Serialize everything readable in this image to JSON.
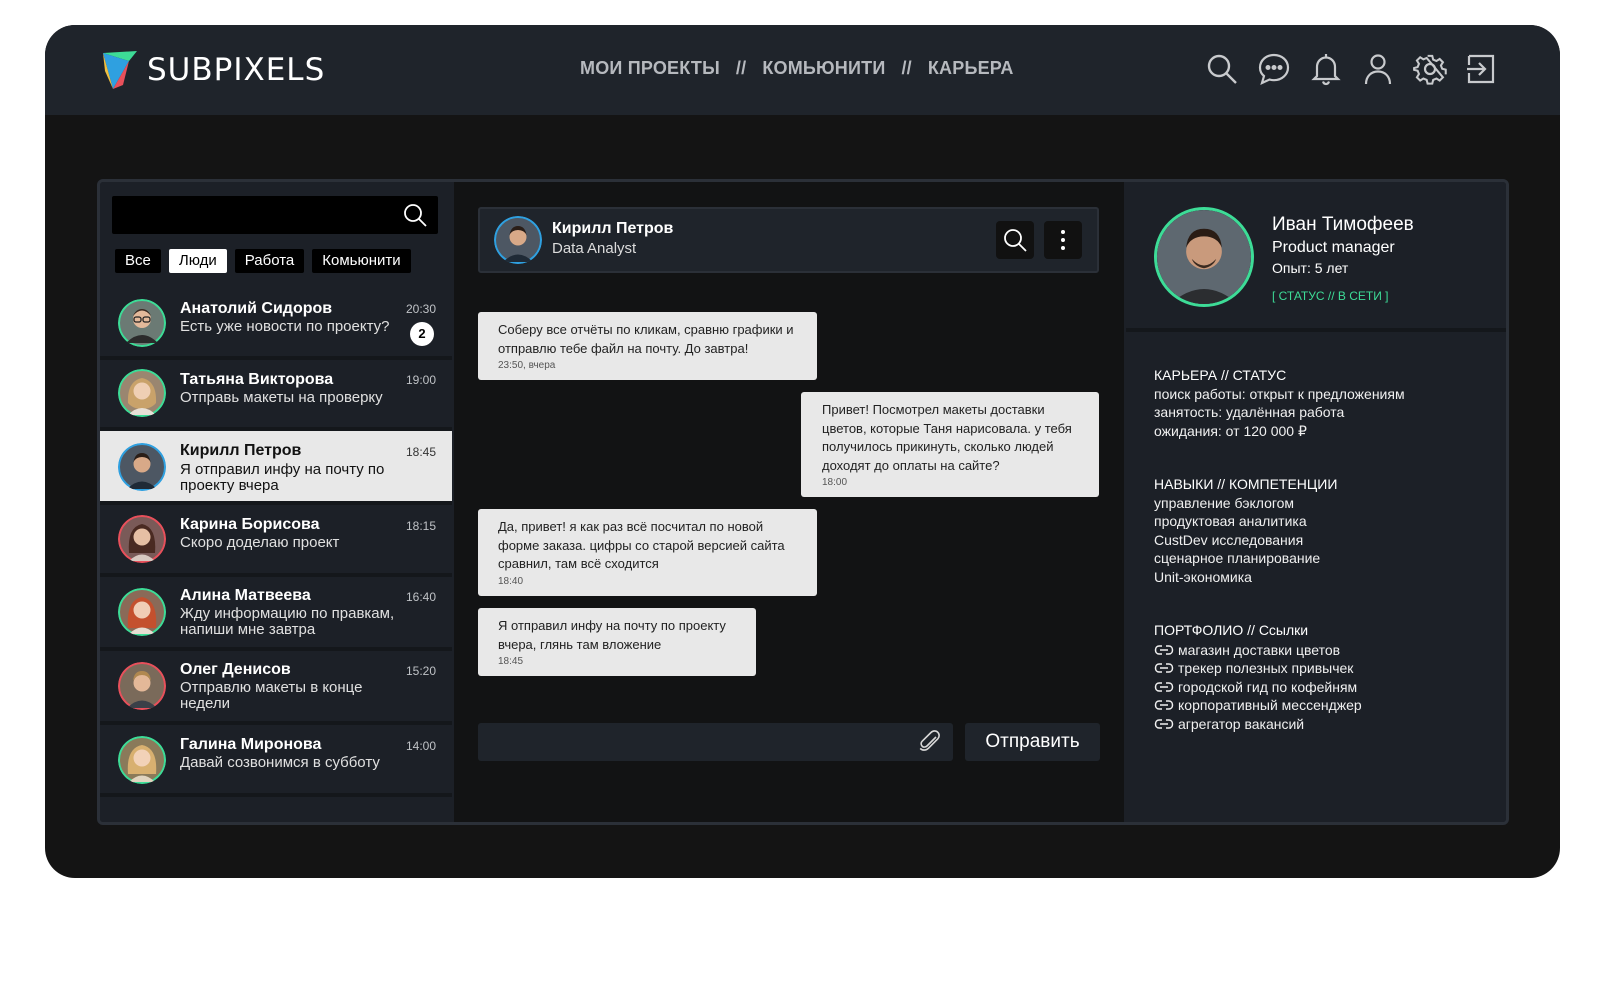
{
  "app": {
    "name": "SUBPIXELS"
  },
  "nav": {
    "items": [
      "МОИ ПРОЕКТЫ",
      "КОМЬЮНИТИ",
      "КАРЬЕРА"
    ],
    "separator": "//"
  },
  "top_icons": [
    "search-icon",
    "chat-icon",
    "bell-icon",
    "user-icon",
    "gear-icon",
    "logout-icon"
  ],
  "sidebar": {
    "search_placeholder": "",
    "filters": [
      "Все",
      "Люди",
      "Работа",
      "Комьюнити"
    ],
    "active_filter": "Люди",
    "contacts": [
      {
        "name": "Анатолий Сидоров",
        "message": "Есть уже новости по проекту?",
        "time": "20:30",
        "badge": "2"
      },
      {
        "name": "Татьяна Викторова",
        "message": "Отправь макеты на проверку",
        "time": "19:00"
      },
      {
        "name": "Кирилл Петров",
        "message": "Я отправил инфу на почту по проекту вчера",
        "time": "18:45",
        "active": true
      },
      {
        "name": "Карина Борисова",
        "message": "Скоро доделаю проект",
        "time": "18:15"
      },
      {
        "name": "Алина Матвеева",
        "message": "Жду информацию по правкам, напиши мне завтра",
        "time": "16:40"
      },
      {
        "name": "Олег Денисов",
        "message": "Отправлю макеты в конце недели",
        "time": "15:20"
      },
      {
        "name": "Галина Миронова",
        "message": "Давай созвонимся в субботу",
        "time": "14:00"
      }
    ]
  },
  "chat": {
    "contact_name": "Кирилл Петров",
    "contact_role": "Data Analyst",
    "messages": [
      {
        "text": "Соберу все отчёты по кликам, сравню графики и отправлю тебе файл на почту. До завтра!",
        "time": "23:50, вчера",
        "side": "left"
      },
      {
        "text": "Привет! Посмотрел макеты доставки цветов, которые Таня нарисовала. у тебя получилось прикинуть, сколько людей доходят до оплаты на сайте?",
        "time": "18:00",
        "side": "right"
      },
      {
        "text": "Да, привет! я как раз всё посчитал по новой форме заказа. цифры со старой версией сайта сравнил, там всё сходится",
        "time": "18:40",
        "side": "left"
      },
      {
        "text": "Я отправил инфу на почту по проекту вчера, глянь там вложение",
        "time": "18:45",
        "side": "left"
      }
    ],
    "compose_placeholder": "",
    "send_label": "Отправить"
  },
  "profile": {
    "name": "Иван Тимофеев",
    "role": "Product manager",
    "experience": "Опыт: 5 лет",
    "status": "[ СТАТУС // В СЕТИ ]",
    "career": {
      "title": "КАРЬЕРА // СТАТУС",
      "lines": [
        "поиск работы: открыт к предложениям",
        "занятость: удалённая работа",
        "ожидания: от 120 000 ₽"
      ]
    },
    "skills": {
      "title": "НАВЫКИ // КОМПЕТЕНЦИИ",
      "lines": [
        "управление бэклогом",
        "продуктовая аналитика",
        "CustDev исследования",
        "сценарное планирование",
        "Unit-экономика"
      ]
    },
    "portfolio": {
      "title": "ПОРТФОЛИО // Ссылки",
      "links": [
        "магазин доставки цветов",
        "трекер полезных привычек",
        "городской гид по кофейням",
        "корпоративный мессенджер",
        "агрегатор вакансий"
      ]
    }
  },
  "colors": {
    "accent": "#3ddc97",
    "topbar": "#1f242b",
    "background": "#141414",
    "bubble": "#e8e8e8"
  }
}
